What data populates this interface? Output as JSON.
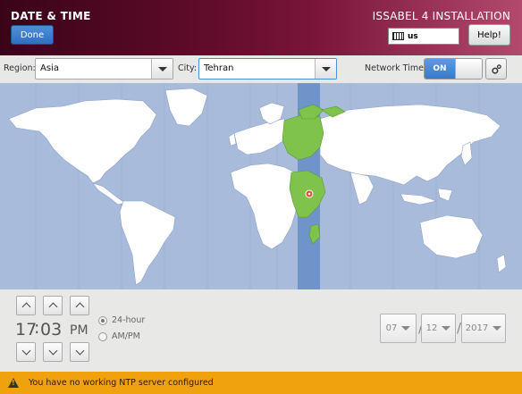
{
  "header": {
    "title": "DATE & TIME",
    "done_label": "Done",
    "install_title": "ISSABEL 4 INSTALLATION",
    "keyboard_layout": "us",
    "help_label": "Help!"
  },
  "toolbar": {
    "region_label": "Region:",
    "region_value": "Asia",
    "city_label": "City:",
    "city_value": "Tehran",
    "network_time_label": "Network Time",
    "network_time_state": "ON"
  },
  "map": {
    "ocean_color": "#a9bbdb",
    "land_color": "#ffffff",
    "selected_zone_color": "#7fc34c",
    "highlight_band_color": "#6f94c9",
    "pin_icon": "location-pin-icon"
  },
  "time": {
    "hours": "17",
    "separator": ":",
    "minutes": "03",
    "period": "PM",
    "format_24h_label": "24-hour",
    "format_ampm_label": "AM/PM"
  },
  "date": {
    "month": "07",
    "day": "12",
    "year": "2017",
    "separator": "/"
  },
  "warning": {
    "text": "You have no working NTP server configured",
    "color": "#f0a20e"
  }
}
